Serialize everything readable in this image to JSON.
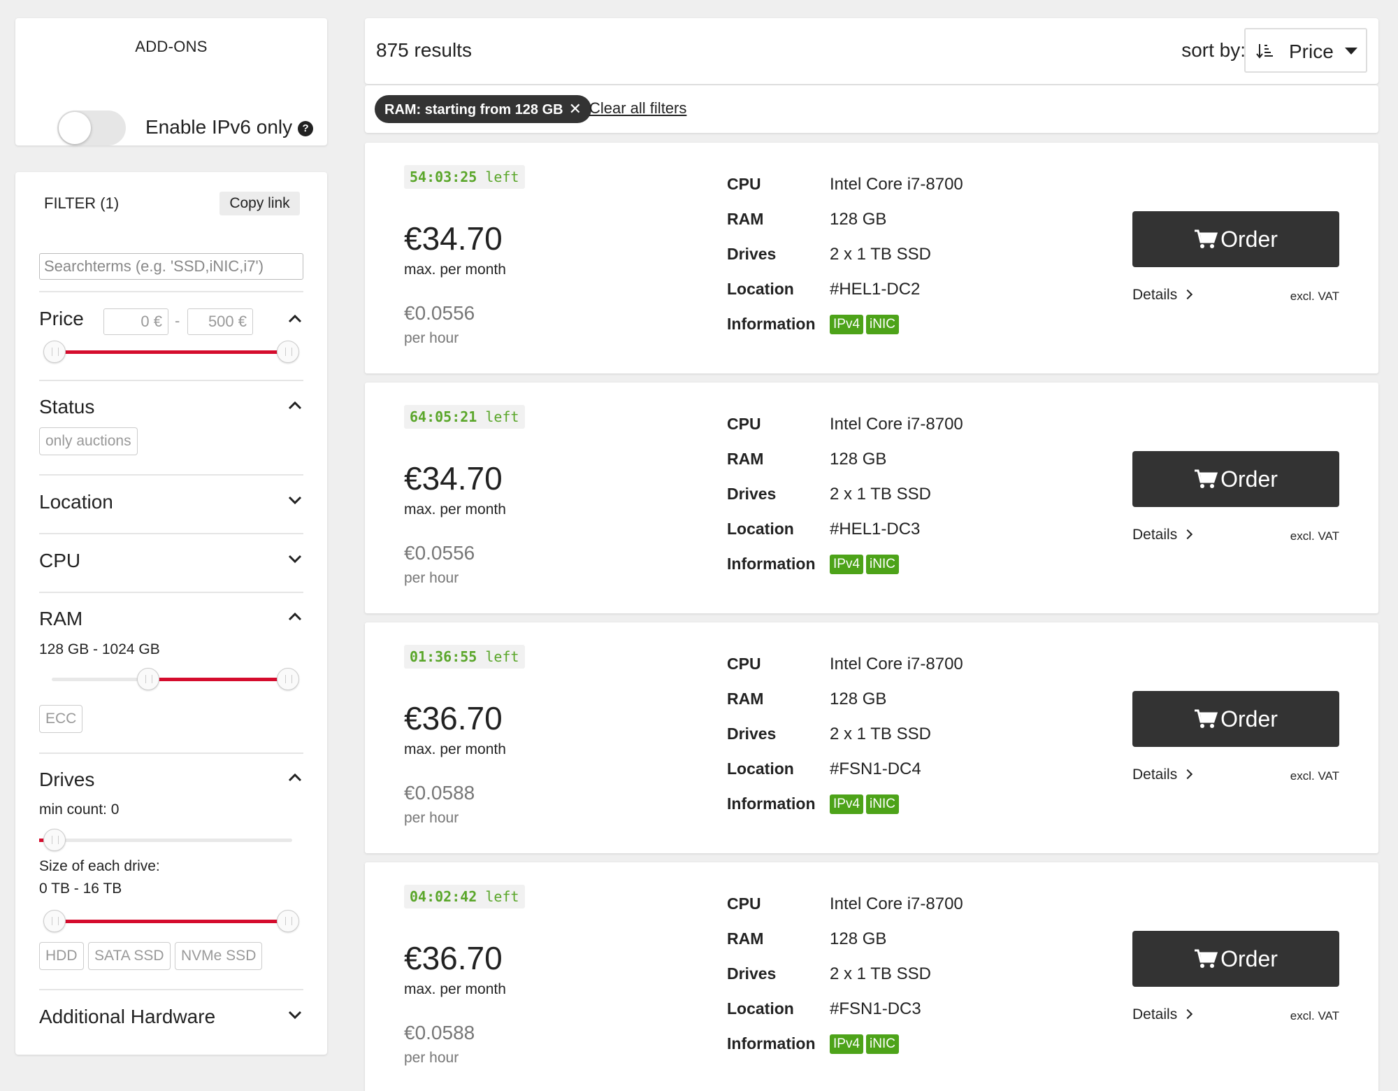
{
  "addons": {
    "title": "ADD-ONS",
    "ipv6_label": "Enable IPv6 only",
    "ipv6_enabled": false,
    "help_icon": "question-circle-icon"
  },
  "filter": {
    "title": "FILTER (1)",
    "copy_link_label": "Copy link",
    "search_placeholder": "Searchterms (e.g. 'SSD,iNIC,i7')",
    "price": {
      "label": "Price",
      "min_value": "0 €",
      "max_value": "500 €",
      "separator": "-",
      "range_min": 0,
      "range_max": 500
    },
    "status": {
      "label": "Status",
      "chips": [
        "only auctions"
      ]
    },
    "location": {
      "label": "Location"
    },
    "cpu": {
      "label": "CPU"
    },
    "ram": {
      "label": "RAM",
      "range_text": "128 GB - 1024 GB",
      "chips": [
        "ECC"
      ]
    },
    "drives": {
      "label": "Drives",
      "min_count_text": "min count: 0",
      "size_label": "Size of each drive:",
      "size_range_text": "0 TB - 16 TB",
      "chips": [
        "HDD",
        "SATA SSD",
        "NVMe SSD"
      ]
    },
    "additional_hardware": {
      "label": "Additional Hardware"
    }
  },
  "results": {
    "count_text": "875 results",
    "sort_label": "sort by:",
    "sort_value": "Price",
    "active_filter": "RAM: starting from 128 GB",
    "clear_all": "Clear all filters"
  },
  "colors": {
    "accent_red": "#d50c2d",
    "tag_green": "#4da319",
    "timer_green": "#5aa62a",
    "button_dark": "#333333"
  },
  "spec_keys": {
    "cpu": "CPU",
    "ram": "RAM",
    "drives": "Drives",
    "location": "Location",
    "information": "Information"
  },
  "card_labels": {
    "left_suffix": "left",
    "max_per_month": "max. per month",
    "per_hour": "per hour",
    "order": "Order",
    "details": "Details",
    "excl_vat": "excl. VAT"
  },
  "products": [
    {
      "timer": "54:03:25",
      "price": "€34.70",
      "hourly": "€0.0556",
      "cpu": "Intel Core i7-8700",
      "ram": "128 GB",
      "drives": "2 x 1 TB SSD",
      "location": "#HEL1-DC2",
      "tags": [
        "IPv4",
        "iNIC"
      ]
    },
    {
      "timer": "64:05:21",
      "price": "€34.70",
      "hourly": "€0.0556",
      "cpu": "Intel Core i7-8700",
      "ram": "128 GB",
      "drives": "2 x 1 TB SSD",
      "location": "#HEL1-DC3",
      "tags": [
        "IPv4",
        "iNIC"
      ]
    },
    {
      "timer": "01:36:55",
      "price": "€36.70",
      "hourly": "€0.0588",
      "cpu": "Intel Core i7-8700",
      "ram": "128 GB",
      "drives": "2 x 1 TB SSD",
      "location": "#FSN1-DC4",
      "tags": [
        "IPv4",
        "iNIC"
      ]
    },
    {
      "timer": "04:02:42",
      "price": "€36.70",
      "hourly": "€0.0588",
      "cpu": "Intel Core i7-8700",
      "ram": "128 GB",
      "drives": "2 x 1 TB SSD",
      "location": "#FSN1-DC3",
      "tags": [
        "IPv4",
        "iNIC"
      ]
    }
  ]
}
